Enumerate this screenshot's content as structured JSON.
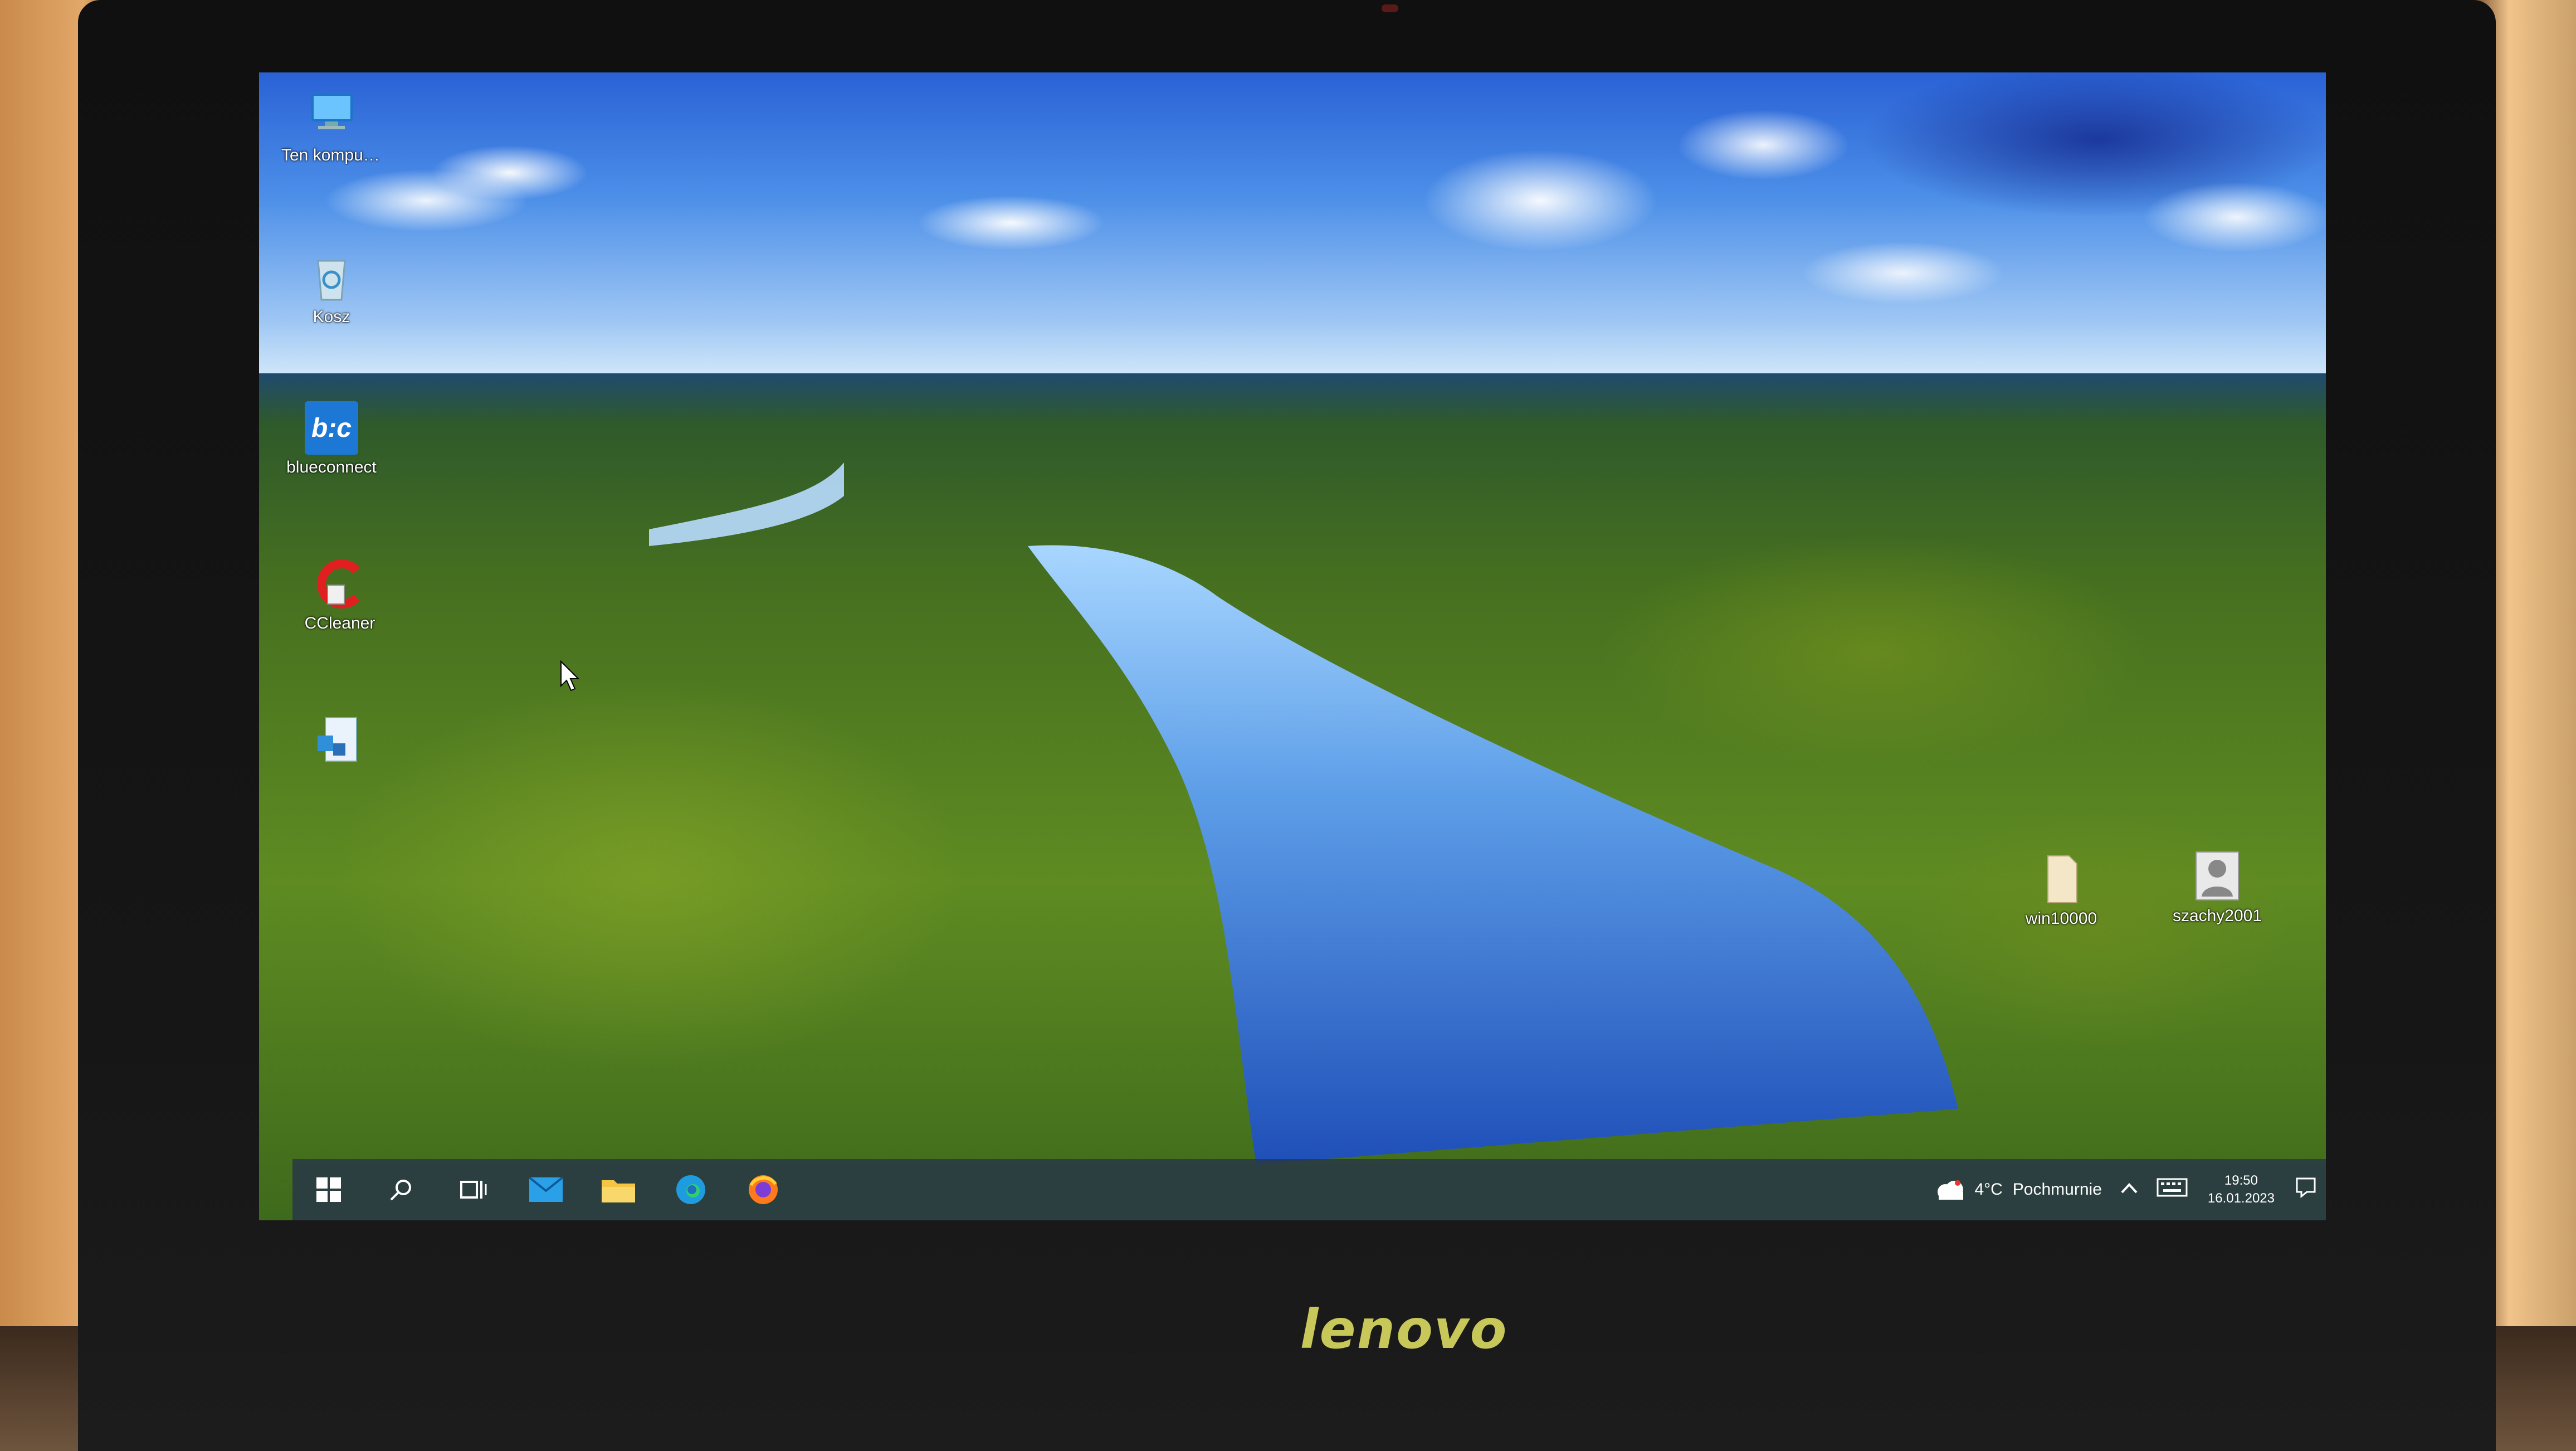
{
  "device": {
    "brand": "lenovo"
  },
  "desktop": {
    "icons": [
      {
        "label": "Ten komputer",
        "icon": "computer-icon"
      },
      {
        "label": "Kosz",
        "icon": "recycle-bin-icon"
      },
      {
        "label": "blueconnect",
        "icon": "blueconnect-app-icon",
        "glyph": "b:c"
      },
      {
        "label": "CCleaner",
        "icon": "ccleaner-icon"
      },
      {
        "label": "",
        "icon": "document-icon"
      },
      {
        "label": "win10000",
        "icon": "file-icon"
      },
      {
        "label": "szachy2001",
        "icon": "user-icon"
      }
    ]
  },
  "taskbar": {
    "pinned": [
      {
        "name": "start-button",
        "icon": "windows-logo-icon"
      },
      {
        "name": "search-button",
        "icon": "search-icon"
      },
      {
        "name": "task-view-button",
        "icon": "task-view-icon"
      },
      {
        "name": "mail-app-button",
        "icon": "mail-icon"
      },
      {
        "name": "file-explorer-button",
        "icon": "folder-icon"
      },
      {
        "name": "edge-browser-button",
        "icon": "edge-icon"
      },
      {
        "name": "firefox-browser-button",
        "icon": "firefox-icon"
      }
    ],
    "weather": {
      "temperature": "4°C",
      "condition": "Pochmurnie"
    },
    "clock": {
      "time": "19:50",
      "date": "16.01.2023"
    }
  },
  "colors": {
    "taskbar_bg": "#28374699",
    "accent": "#0078d7"
  }
}
